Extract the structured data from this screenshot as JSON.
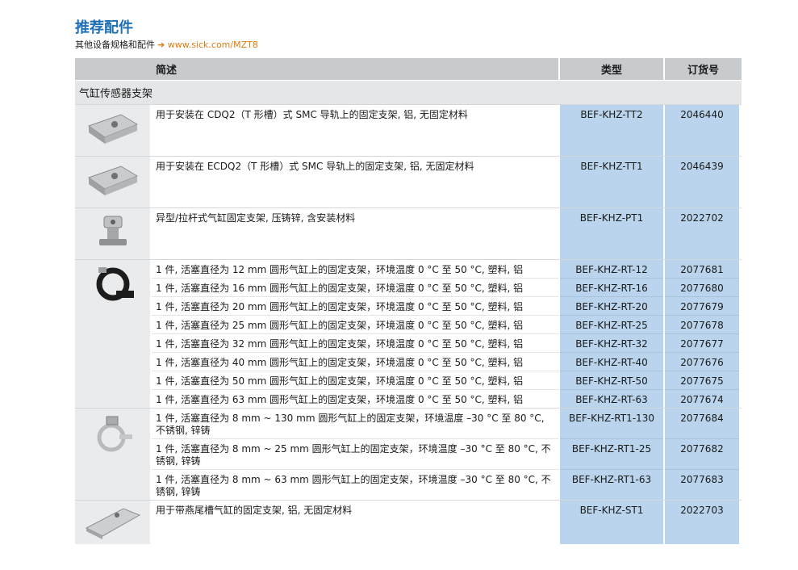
{
  "header": {
    "title": "推荐配件",
    "subtitle_text": "其他设备规格和配件",
    "subtitle_arrow": "➜",
    "subtitle_link": "www.sick.com/MZT8"
  },
  "table": {
    "columns": [
      "简述",
      "类型",
      "订货号"
    ],
    "section": "气缸传感器支架",
    "groups": [
      {
        "icon": "rail-bracket-icon",
        "height": 63,
        "rows": [
          {
            "desc": "用于安装在 CDQ2（T 形槽）式 SMC 导轨上的固定支架, 铝, 无固定材料",
            "type": "BEF-KHZ-TT2",
            "order": "2046440"
          }
        ]
      },
      {
        "icon": "rail-bracket-icon",
        "height": 63,
        "rows": [
          {
            "desc": "用于安装在 ECDQ2（T 形槽）式 SMC 导轨上的固定支架, 铝, 无固定材料",
            "type": "BEF-KHZ-TT1",
            "order": "2046439"
          }
        ]
      },
      {
        "icon": "clamp-bracket-icon",
        "height": 63,
        "rows": [
          {
            "desc": "异型/拉杆式气缸固定支架, 压铸锌, 含安装材料",
            "type": "BEF-KHZ-PT1",
            "order": "2022702"
          }
        ]
      },
      {
        "icon": "strap-bracket-icon",
        "rows": [
          {
            "desc": "1 件, 活塞直径为 12 mm 圆形气缸上的固定支架，环境温度 0 °C 至 50 °C, 塑料, 铝",
            "type": "BEF-KHZ-RT-12",
            "order": "2077681"
          },
          {
            "desc": "1 件, 活塞直径为 16 mm 圆形气缸上的固定支架，环境温度 0 °C 至 50 °C, 塑料, 铝",
            "type": "BEF-KHZ-RT-16",
            "order": "2077680"
          },
          {
            "desc": "1 件, 活塞直径为 20 mm 圆形气缸上的固定支架，环境温度 0 °C 至 50 °C, 塑料, 铝",
            "type": "BEF-KHZ-RT-20",
            "order": "2077679"
          },
          {
            "desc": "1 件, 活塞直径为 25 mm 圆形气缸上的固定支架，环境温度 0 °C 至 50 °C, 塑料, 铝",
            "type": "BEF-KHZ-RT-25",
            "order": "2077678"
          },
          {
            "desc": "1 件, 活塞直径为 32 mm 圆形气缸上的固定支架，环境温度 0 °C 至 50 °C, 塑料, 铝",
            "type": "BEF-KHZ-RT-32",
            "order": "2077677"
          },
          {
            "desc": "1 件, 活塞直径为 40 mm 圆形气缸上的固定支架，环境温度 0 °C 至 50 °C, 塑料, 铝",
            "type": "BEF-KHZ-RT-40",
            "order": "2077676"
          },
          {
            "desc": "1 件, 活塞直径为 50 mm 圆形气缸上的固定支架，环境温度 0 °C 至 50 °C, 塑料, 铝",
            "type": "BEF-KHZ-RT-50",
            "order": "2077675"
          },
          {
            "desc": "1 件, 活塞直径为 63 mm 圆形气缸上的固定支架，环境温度 0 °C 至 50 °C, 塑料, 铝",
            "type": "BEF-KHZ-RT-63",
            "order": "2077674"
          }
        ]
      },
      {
        "icon": "hose-clamp-icon",
        "rows": [
          {
            "desc": "1 件, 活塞直径为 8 mm ~ 130 mm 圆形气缸上的固定支架，环境温度 –30 °C 至 80 °C, 不锈钢, 锌铸",
            "type": "BEF-KHZ-RT1-130",
            "order": "2077684"
          },
          {
            "desc": "1 件, 活塞直径为 8 mm ~ 25 mm 圆形气缸上的固定支架，环境温度 –30 °C 至 80 °C, 不锈钢, 锌铸",
            "type": "BEF-KHZ-RT1-25",
            "order": "2077682"
          },
          {
            "desc": "1 件, 活塞直径为 8 mm ~ 63 mm 圆形气缸上的固定支架，环境温度 –30 °C 至 80 °C, 不锈钢, 锌铸",
            "type": "BEF-KHZ-RT1-63",
            "order": "2077683"
          }
        ]
      },
      {
        "icon": "dovetail-bracket-icon",
        "height": 54,
        "rows": [
          {
            "desc": "用于带燕尾槽气缸的固定支架, 铝, 无固定材料",
            "type": "BEF-KHZ-ST1",
            "order": "2022703"
          }
        ]
      }
    ]
  }
}
